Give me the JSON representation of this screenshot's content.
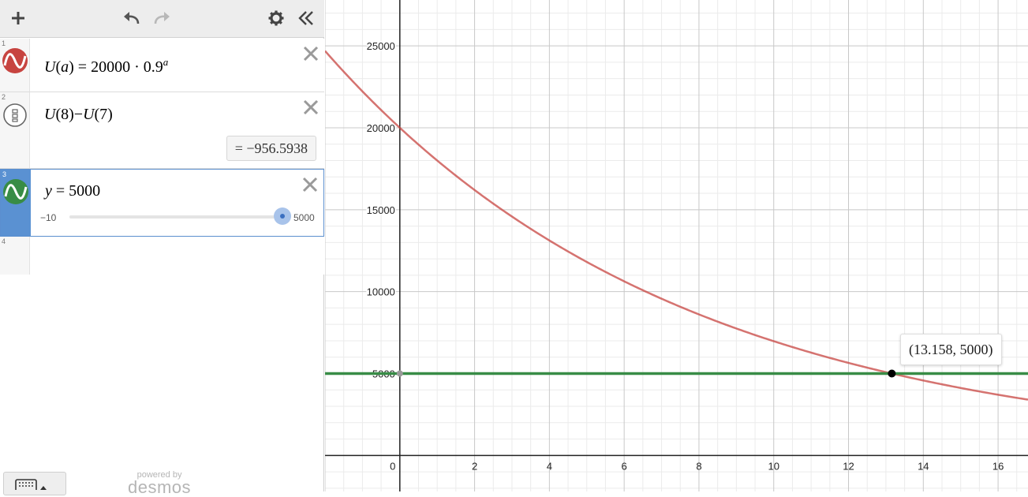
{
  "toolbar": {
    "add_icon": "plus-icon",
    "undo_icon": "undo-icon",
    "redo_icon": "redo-icon",
    "settings_icon": "gear-icon",
    "collapse_icon": "double-chevron-left-icon"
  },
  "expressions": [
    {
      "number": "1",
      "color": "#c74440",
      "icon": "wave-icon",
      "fn": "U",
      "arg": "a",
      "eq": " = 20000 · 0.9",
      "exp": "a"
    },
    {
      "number": "2",
      "icon": "calculator-icon",
      "text_a": "U",
      "text_b": "(8)−",
      "text_c": "U",
      "text_d": "(7)",
      "result": "=  −956.5938"
    },
    {
      "number": "3",
      "color": "#388c46",
      "icon": "wave-icon",
      "var": "y",
      "eq": " = 5000",
      "slider_min": "−10",
      "slider_max": "5000",
      "slider_value": 5000,
      "slider_range": [
        -10,
        5000
      ]
    },
    {
      "number": "4"
    }
  ],
  "branding": {
    "line1": "powered by",
    "line2": "desmos"
  },
  "chart_data": {
    "type": "line",
    "xlim": [
      -2,
      16.8
    ],
    "ylim": [
      -2200,
      27800
    ],
    "grid": true,
    "x_ticks": [
      "0",
      "2",
      "4",
      "6",
      "8",
      "10",
      "12",
      "14",
      "16"
    ],
    "y_ticks": [
      "5000",
      "10000",
      "15000",
      "20000",
      "25000"
    ],
    "series": [
      {
        "expression": "U(a) = 20000 · 0.9^a",
        "color": "#c74440",
        "base": 20000,
        "rate": 0.9
      },
      {
        "expression": "y = 5000",
        "color": "#388c46",
        "y": 5000
      }
    ],
    "intersection": {
      "x": 13.158,
      "y": 5000,
      "label": "(13.158, 5000)"
    }
  }
}
